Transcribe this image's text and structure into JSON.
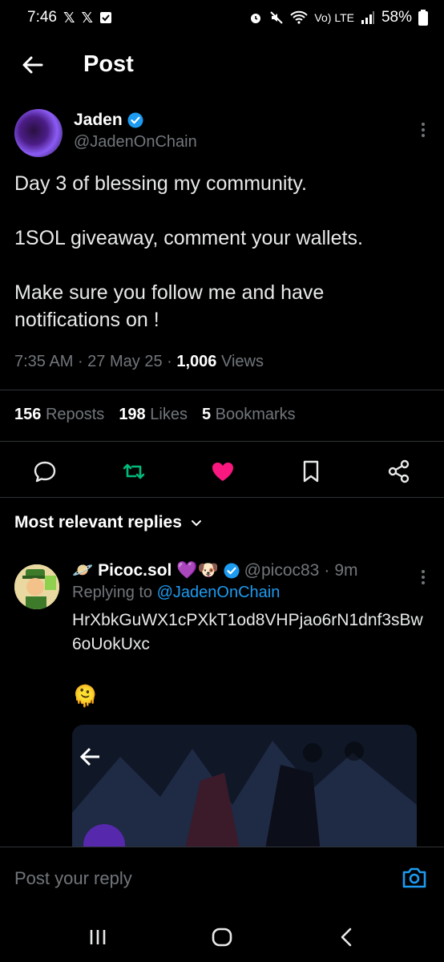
{
  "status_bar": {
    "time": "7:46",
    "battery": "58%",
    "network": "Vo) LTE"
  },
  "header": {
    "title": "Post"
  },
  "post": {
    "name": "Jaden",
    "handle": "@JadenOnChain",
    "paragraphs": [
      "Day 3 of blessing my community.",
      "1SOL giveaway, comment your wallets.",
      "Make sure you follow me and have notifications on !"
    ],
    "time": "7:35 AM",
    "date": "27 May 25",
    "views_count": "1,006",
    "views_label": "Views",
    "reposts_count": "156",
    "reposts_label": "Reposts",
    "likes_count": "198",
    "likes_label": "Likes",
    "bookmarks_count": "5",
    "bookmarks_label": "Bookmarks"
  },
  "replies_filter": {
    "label": "Most relevant replies"
  },
  "reply": {
    "prefix_emoji": "🪐",
    "name": "Picoc.sol",
    "name_emojis": "💜🐶",
    "handle": "@picoc83",
    "age": "9m",
    "replying_label": "Replying to",
    "replying_to": "@JadenOnChain",
    "text": "HrXbkGuWX1cPXkT1od8VHPjao6rN1dnf3sBw6oUokUxc",
    "emoji": "🫠"
  },
  "composer": {
    "placeholder": "Post your reply"
  },
  "colors": {
    "accent": "#1d9bf0",
    "like": "#f91880",
    "repost": "#00ba7c",
    "muted": "#71767b"
  }
}
